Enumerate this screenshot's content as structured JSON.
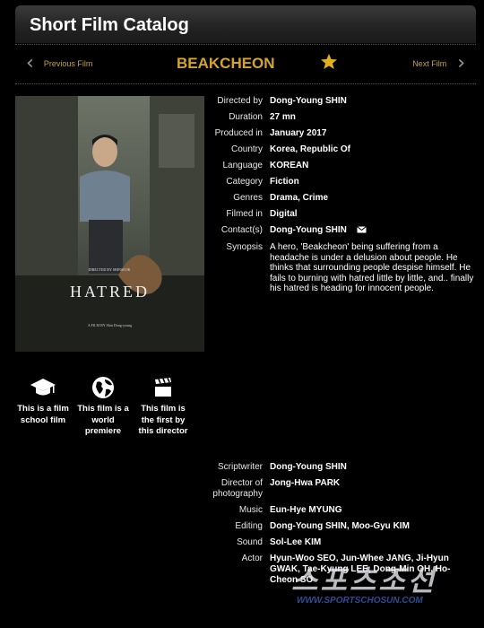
{
  "header": {
    "title": "Short Film Catalog"
  },
  "nav": {
    "prev_label": "Previous Film",
    "next_label": "Next Film",
    "film_title": "BEAKCHEON"
  },
  "poster": {
    "title_text": "HATRED",
    "credit_text": "A FILM BY Shin Dong-young"
  },
  "info": [
    {
      "label": "Directed by",
      "value": "Dong-Young SHIN"
    },
    {
      "label": "Duration",
      "value": "27 mn"
    },
    {
      "label": "Produced in",
      "value": "January 2017"
    },
    {
      "label": "Country",
      "value": "Korea, Republic Of"
    },
    {
      "label": "Language",
      "value": "KOREAN"
    },
    {
      "label": "Category",
      "value": "Fiction"
    },
    {
      "label": "Genres",
      "value": "Drama, Crime"
    },
    {
      "label": "Filmed in",
      "value": "Digital"
    },
    {
      "label": "Contact(s)",
      "value": "Dong-Young SHIN"
    },
    {
      "label": "Synopsis",
      "value": "A hero, 'Beakcheon' being suffering from a headache is under a delusion about people. He thinks that surrounding people despise himself. He fails to burning with hatred little by little, and.. finally his hatred is heading for innocent people."
    }
  ],
  "badges": [
    {
      "icon": "graduation-cap-icon",
      "text": "This is a film school film"
    },
    {
      "icon": "globe-icon",
      "text": "This film is a world premiere"
    },
    {
      "icon": "clapperboard-icon",
      "text": "This film is the first by this director"
    }
  ],
  "crew": [
    {
      "label": "Scriptwriter",
      "value": "Dong-Young SHIN"
    },
    {
      "label": "Director of photography",
      "value": "Jong-Hwa PARK"
    },
    {
      "label": "Music",
      "value": "Eun-Hye MYUNG"
    },
    {
      "label": "Editing",
      "value": "Dong-Young SHIN, Moo-Gyu KIM"
    },
    {
      "label": "Sound",
      "value": "Sol-Lee KIM"
    },
    {
      "label": "Actor",
      "value": "Hyun-Woo SEO, Jun-Whee JANG, Ji-Hyun GWAK, Tae-Kyung LEE, Dong-Min OH, Ho-Cheon SO"
    }
  ],
  "watermark": {
    "korean": "스포츠조선",
    "url": "WWW.SPORTSCHOSUN.COM"
  },
  "colors": {
    "accent": "#d4a52a",
    "nav_link": "#c7a13c",
    "background": "#000000"
  }
}
